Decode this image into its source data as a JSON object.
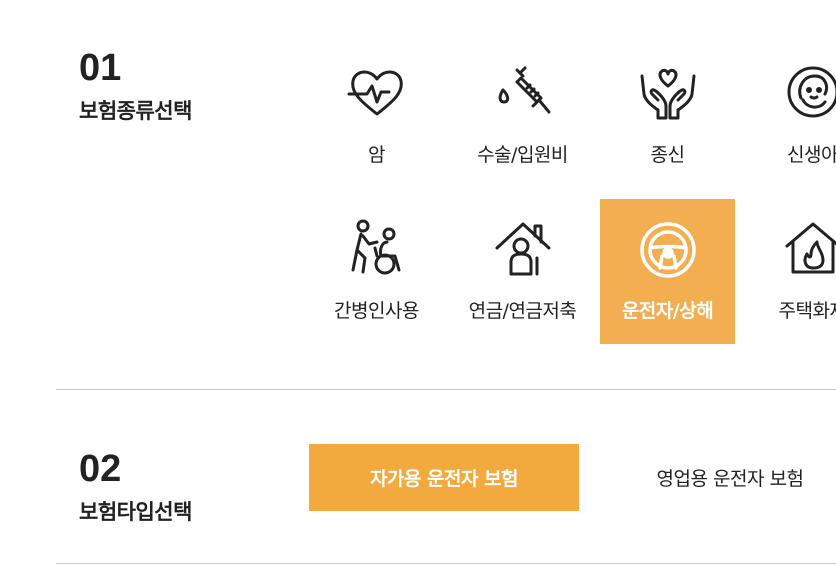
{
  "section1": {
    "number": "01",
    "title": "보험종류선택",
    "categories": [
      {
        "label": "암",
        "icon": "heart-pulse-icon"
      },
      {
        "label": "수술/입원비",
        "icon": "syringe-icon"
      },
      {
        "label": "종신",
        "icon": "hands-heart-icon"
      },
      {
        "label": "신생아",
        "icon": "baby-icon"
      },
      {
        "label": "간병인사용",
        "icon": "caregiver-icon"
      },
      {
        "label": "연금/연금저축",
        "icon": "elder-home-icon"
      },
      {
        "label": "운전자/상해",
        "icon": "steering-wheel-icon",
        "selected": true
      },
      {
        "label": "주택화재",
        "icon": "house-fire-icon"
      }
    ]
  },
  "section2": {
    "number": "02",
    "title": "보험타입선택",
    "options": [
      {
        "label": "자가용 운전자 보험",
        "selected": true
      },
      {
        "label": "영업용 운전자 보험",
        "selected": false
      }
    ]
  },
  "colors": {
    "accent_category": "#f2ae50",
    "accent_button": "#f2a93e",
    "text": "#222222",
    "divider": "#c8c8c8"
  }
}
